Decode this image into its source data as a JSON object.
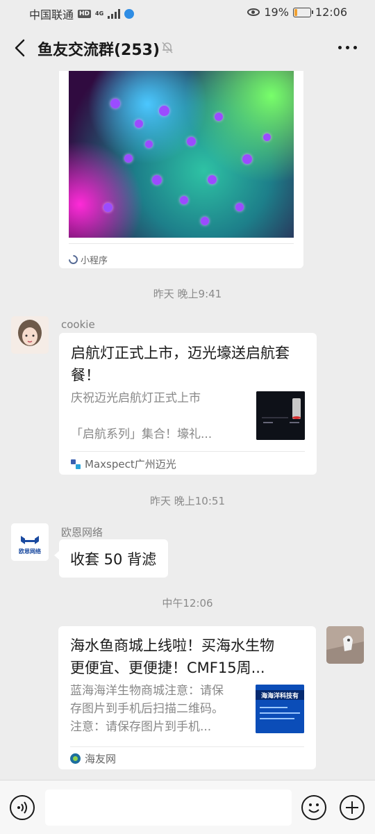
{
  "status_bar": {
    "carrier": "中国联通",
    "hd": "HD",
    "network": "4G",
    "battery_percent": "19%",
    "battery_level": 0.19,
    "time": "12:06"
  },
  "header": {
    "title": "鱼友交流群(253)",
    "icons": [
      "back-icon",
      "mute-bell-icon",
      "more-icon"
    ]
  },
  "messages": [
    {
      "type": "mini_program",
      "label": "小程序"
    },
    {
      "type": "time",
      "text": "昨天 晚上9:41"
    },
    {
      "type": "article",
      "sender": "cookie",
      "title": "启航灯正式上市，迈光壕送启航套餐！",
      "desc_lines": [
        "庆祝迈光启航灯正式上市",
        "",
        "「启航系列」集合！壕礼..."
      ],
      "source": "Maxspect广州迈光"
    },
    {
      "type": "time",
      "text": "昨天 晚上10:51"
    },
    {
      "type": "text",
      "sender": "欧恩网络",
      "avatar_text": "欧恩网络",
      "text": "收套 50 背滤"
    },
    {
      "type": "time",
      "text": "中午12:06"
    },
    {
      "type": "article",
      "sender": "self",
      "title_lines": [
        "海水鱼商城上线啦！买海水生物",
        "更便宜、更便捷！CMF15周..."
      ],
      "desc_lines": [
        "蓝海海洋生物商城注意：请保",
        "存图片到手机后扫描二维码。",
        "注意：请保存图片到手机..."
      ],
      "thumb_text": "海海洋科技有",
      "source": "海友网"
    }
  ],
  "input_bar": {
    "placeholder": "",
    "icons": [
      "voice-icon",
      "emoji-icon",
      "plus-icon"
    ]
  }
}
